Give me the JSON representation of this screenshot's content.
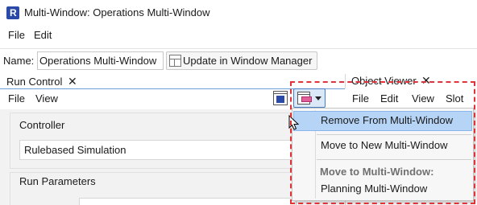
{
  "window": {
    "title": "Multi-Window: Operations Multi-Window"
  },
  "menubar": {
    "file": "File",
    "edit": "Edit"
  },
  "name_row": {
    "label": "Name:",
    "value": "Operations Multi-Window",
    "update_button": "Update in Window Manager"
  },
  "run_control": {
    "tab_label": "Run Control",
    "close": "✕",
    "menu": {
      "file": "File",
      "view": "View"
    },
    "controller_label": "Controller",
    "controller_value": "Rulebased Simulation",
    "run_params_label": "Run Parameters"
  },
  "object_viewer": {
    "tab_label": "Object Viewer",
    "close": "✕",
    "menu": [
      "File",
      "Edit",
      "View",
      "Slot"
    ]
  },
  "dropdown": {
    "remove": "Remove From Multi-Window",
    "move_new": "Move to New Multi-Window",
    "move_to_header": "Move to Multi-Window:",
    "planning": "Planning Multi-Window"
  },
  "colors": {
    "annotation": "#e0333a",
    "highlight": "#b6d4f6",
    "accent": "#2b4aa8"
  },
  "icons": {
    "app": "riverware-app-icon",
    "update": "window-manager-icon",
    "toolbar_1": "multi-window-icon",
    "toolbar_2": "move-window-icon",
    "cursor": "mouse-pointer-icon"
  }
}
